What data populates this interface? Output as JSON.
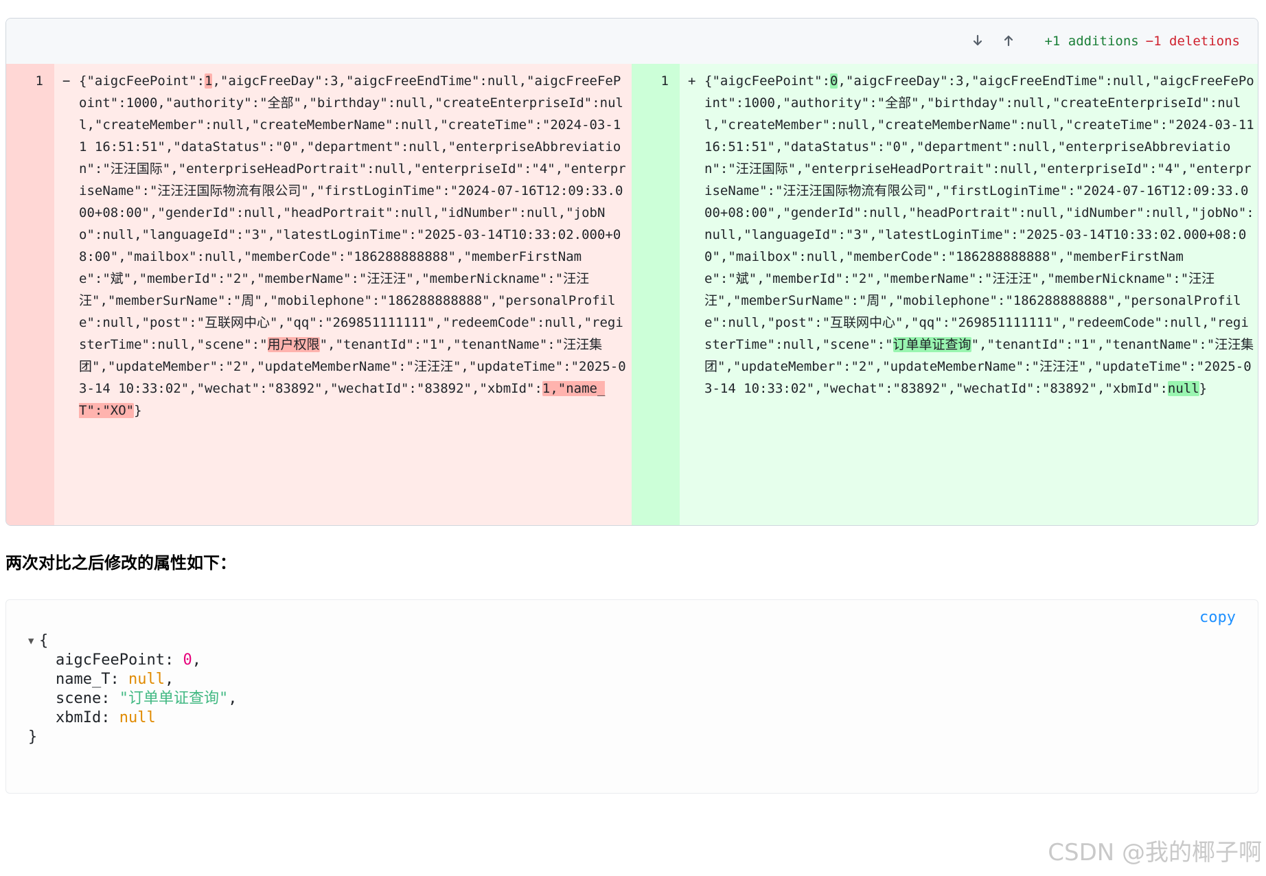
{
  "diff": {
    "stats": {
      "additions": "+1 additions",
      "deletions": "−1 deletions"
    },
    "old": {
      "line_number": "1",
      "marker": "−",
      "segments": [
        {
          "text": "{\"aigcFeePoint\":",
          "hl": false
        },
        {
          "text": "1",
          "hl": true
        },
        {
          "text": ",\"aigcFreeDay\":3,\"aigcFreeEndTime\":null,\"aigcFreeFePoint\":1000,\"authority\":\"全部\",\"birthday\":null,\"createEnterpriseId\":null,\"createMember\":null,\"createMemberName\":null,\"createTime\":\"2024-03-11 16:51:51\",\"dataStatus\":\"0\",\"department\":null,\"enterpriseAbbreviation\":\"汪汪国际\",\"enterpriseHeadPortrait\":null,\"enterpriseId\":\"4\",\"enterpriseName\":\"汪汪汪国际物流有限公司\",\"firstLoginTime\":\"2024-07-16T12:09:33.000+08:00\",\"genderId\":null,\"headPortrait\":null,\"idNumber\":null,\"jobNo\":null,\"languageId\":\"3\",\"latestLoginTime\":\"2025-03-14T10:33:02.000+08:00\",\"mailbox\":null,\"memberCode\":\"186288888888\",\"memberFirstName\":\"斌\",\"memberId\":\"2\",\"memberName\":\"汪汪汪\",\"memberNickname\":\"汪汪汪\",\"memberSurName\":\"周\",\"mobilephone\":\"186288888888\",\"personalProfile\":null,\"post\":\"互联网中心\",\"qq\":\"269851111111\",\"redeemCode\":null,\"registerTime\":null,\"scene\":\"",
          "hl": false
        },
        {
          "text": "用户权限",
          "hl": true
        },
        {
          "text": "\",\"tenantId\":\"1\",\"tenantName\":\"汪汪集团\",\"updateMember\":\"2\",\"updateMemberName\":\"汪汪汪\",\"updateTime\":\"2025-03-14 10:33:02\",\"wechat\":\"83892\",\"wechatId\":\"83892\",\"xbmId\":",
          "hl": false
        },
        {
          "text": "1,\"name_T\":\"XO\"",
          "hl": true
        },
        {
          "text": "}",
          "hl": false
        }
      ]
    },
    "new": {
      "line_number": "1",
      "marker": "+",
      "segments": [
        {
          "text": "{\"aigcFeePoint\":",
          "hl": false
        },
        {
          "text": "0",
          "hl": true
        },
        {
          "text": ",\"aigcFreeDay\":3,\"aigcFreeEndTime\":null,\"aigcFreeFePoint\":1000,\"authority\":\"全部\",\"birthday\":null,\"createEnterpriseId\":null,\"createMember\":null,\"createMemberName\":null,\"createTime\":\"2024-03-11 16:51:51\",\"dataStatus\":\"0\",\"department\":null,\"enterpriseAbbreviation\":\"汪汪国际\",\"enterpriseHeadPortrait\":null,\"enterpriseId\":\"4\",\"enterpriseName\":\"汪汪汪国际物流有限公司\",\"firstLoginTime\":\"2024-07-16T12:09:33.000+08:00\",\"genderId\":null,\"headPortrait\":null,\"idNumber\":null,\"jobNo\":null,\"languageId\":\"3\",\"latestLoginTime\":\"2025-03-14T10:33:02.000+08:00\",\"mailbox\":null,\"memberCode\":\"186288888888\",\"memberFirstName\":\"斌\",\"memberId\":\"2\",\"memberName\":\"汪汪汪\",\"memberNickname\":\"汪汪汪\",\"memberSurName\":\"周\",\"mobilephone\":\"186288888888\",\"personalProfile\":null,\"post\":\"互联网中心\",\"qq\":\"269851111111\",\"redeemCode\":null,\"registerTime\":null,\"scene\":\"",
          "hl": false
        },
        {
          "text": "订单单证查询",
          "hl": true
        },
        {
          "text": "\",\"tenantId\":\"1\",\"tenantName\":\"汪汪集团\",\"updateMember\":\"2\",\"updateMemberName\":\"汪汪汪\",\"updateTime\":\"2025-03-14 10:33:02\",\"wechat\":\"83892\",\"wechatId\":\"83892\",\"xbmId\":",
          "hl": false
        },
        {
          "text": "null",
          "hl": true
        },
        {
          "text": "}",
          "hl": false
        }
      ]
    }
  },
  "section_title": "两次对比之后修改的属性如下：",
  "json_viewer": {
    "copy_label": "copy",
    "open_brace": "{",
    "close_brace": "}",
    "entries": [
      {
        "key": "aigcFeePoint:",
        "value": "0",
        "kind": "num",
        "comma": ","
      },
      {
        "key": "name_T:",
        "value": "null",
        "kind": "null",
        "comma": ","
      },
      {
        "key": "scene:",
        "value": "\"订单单证查询\"",
        "kind": "str",
        "comma": ","
      },
      {
        "key": "xbmId:",
        "value": "null",
        "kind": "null",
        "comma": ""
      }
    ]
  },
  "watermark": "CSDN @我的椰子啊",
  "colors": {
    "addition": "#1a7f37",
    "deletion": "#cf222e",
    "old_bg": "#ffebe9",
    "new_bg": "#e6ffec",
    "copy_link": "#1e90ff",
    "json_number": "#e6007a",
    "json_null": "#e08a00",
    "json_string": "#42b983"
  }
}
